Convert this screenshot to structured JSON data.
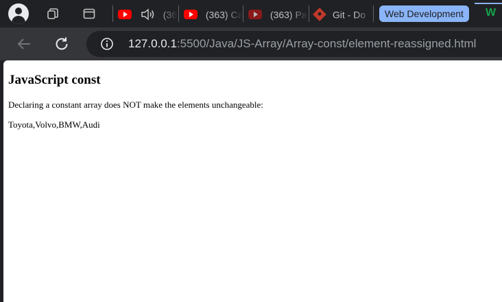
{
  "tabstrip": {
    "tabs": [
      {
        "title": "(36",
        "icon": "youtube-icon",
        "audio_icon": "speaker-icon"
      },
      {
        "title": "(363) Ca",
        "icon": "youtube-icon"
      },
      {
        "title": "(363) Pa",
        "icon": "youtube-icon"
      },
      {
        "title": "Git - Do",
        "icon": "git-icon"
      }
    ],
    "group_label": "Web Development",
    "group_color": "#8ab4f8",
    "extra_icon_text": "W"
  },
  "toolbar": {
    "url_host": "127.0.0.1",
    "url_rest": ":5500/Java/JS-Array/Array-const/element-reassigned.html"
  },
  "page": {
    "heading": "JavaScript const",
    "paragraph": "Declaring a constant array does NOT make the elements unchangeable:",
    "output": "Toyota,Volvo,BMW,Audi"
  },
  "colors": {
    "chrome_dark": "#202124",
    "toolbar": "#35363a",
    "youtube_red": "#ff0000",
    "git_red": "#c0392b",
    "tab_group_blue": "#8ab4f8"
  }
}
